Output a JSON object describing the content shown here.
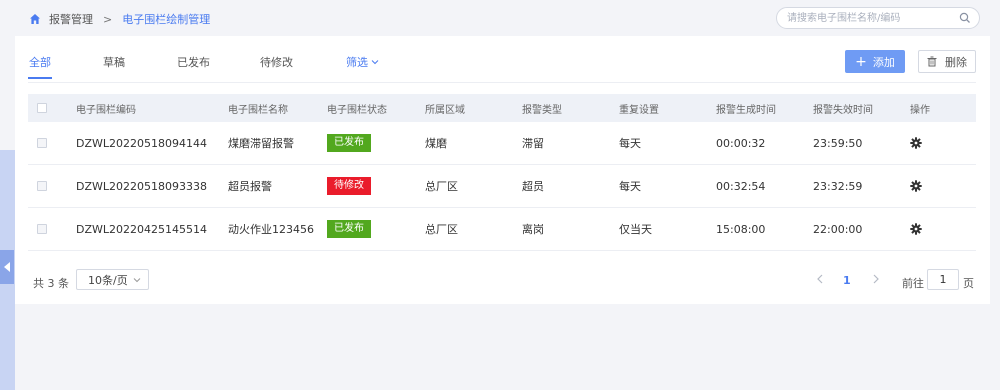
{
  "breadcrumb": {
    "parent": "报警管理",
    "separator": ">",
    "current": "电子围栏绘制管理"
  },
  "search": {
    "placeholder": "请搜索电子围栏名称/编码",
    "value": ""
  },
  "tabs": [
    {
      "label": "全部",
      "active": true
    },
    {
      "label": "草稿",
      "active": false
    },
    {
      "label": "已发布",
      "active": false
    },
    {
      "label": "待修改",
      "active": false
    },
    {
      "label": "筛选",
      "active": false
    }
  ],
  "toolbar": {
    "add_label": "添加",
    "delete_label": "删除"
  },
  "table": {
    "headers": [
      "电子围栏编码",
      "电子围栏名称",
      "电子围栏状态",
      "所属区域",
      "报警类型",
      "重复设置",
      "报警生成时间",
      "报警失效时间",
      "操作"
    ],
    "rows": [
      {
        "code": "DZWL20220518094144",
        "name": "煤磨滞留报警",
        "status": "已发布",
        "status_color": "#52a81e",
        "area": "煤磨",
        "alarm_type": "滞留",
        "repeat": "每天",
        "start": "00:00:32",
        "end": "23:59:50"
      },
      {
        "code": "DZWL20220518093338",
        "name": "超员报警",
        "status": "待修改",
        "status_color": "#ea1c2b",
        "area": "总厂区",
        "alarm_type": "超员",
        "repeat": "每天",
        "start": "00:32:54",
        "end": "23:32:59"
      },
      {
        "code": "DZWL20220425145514",
        "name": "动火作业123456",
        "status": "已发布",
        "status_color": "#52a81e",
        "area": "总厂区",
        "alarm_type": "离岗",
        "repeat": "仅当天",
        "start": "15:08:00",
        "end": "22:00:00"
      }
    ]
  },
  "pagination": {
    "total_text": "共 3 条",
    "page_size": "10条/页",
    "current_page": "1",
    "goto_label": "前往",
    "goto_value": "1",
    "goto_unit": "页"
  },
  "colors": {
    "accent": "#4a7bf0",
    "published": "#52a81e",
    "pending": "#ea1c2b"
  }
}
